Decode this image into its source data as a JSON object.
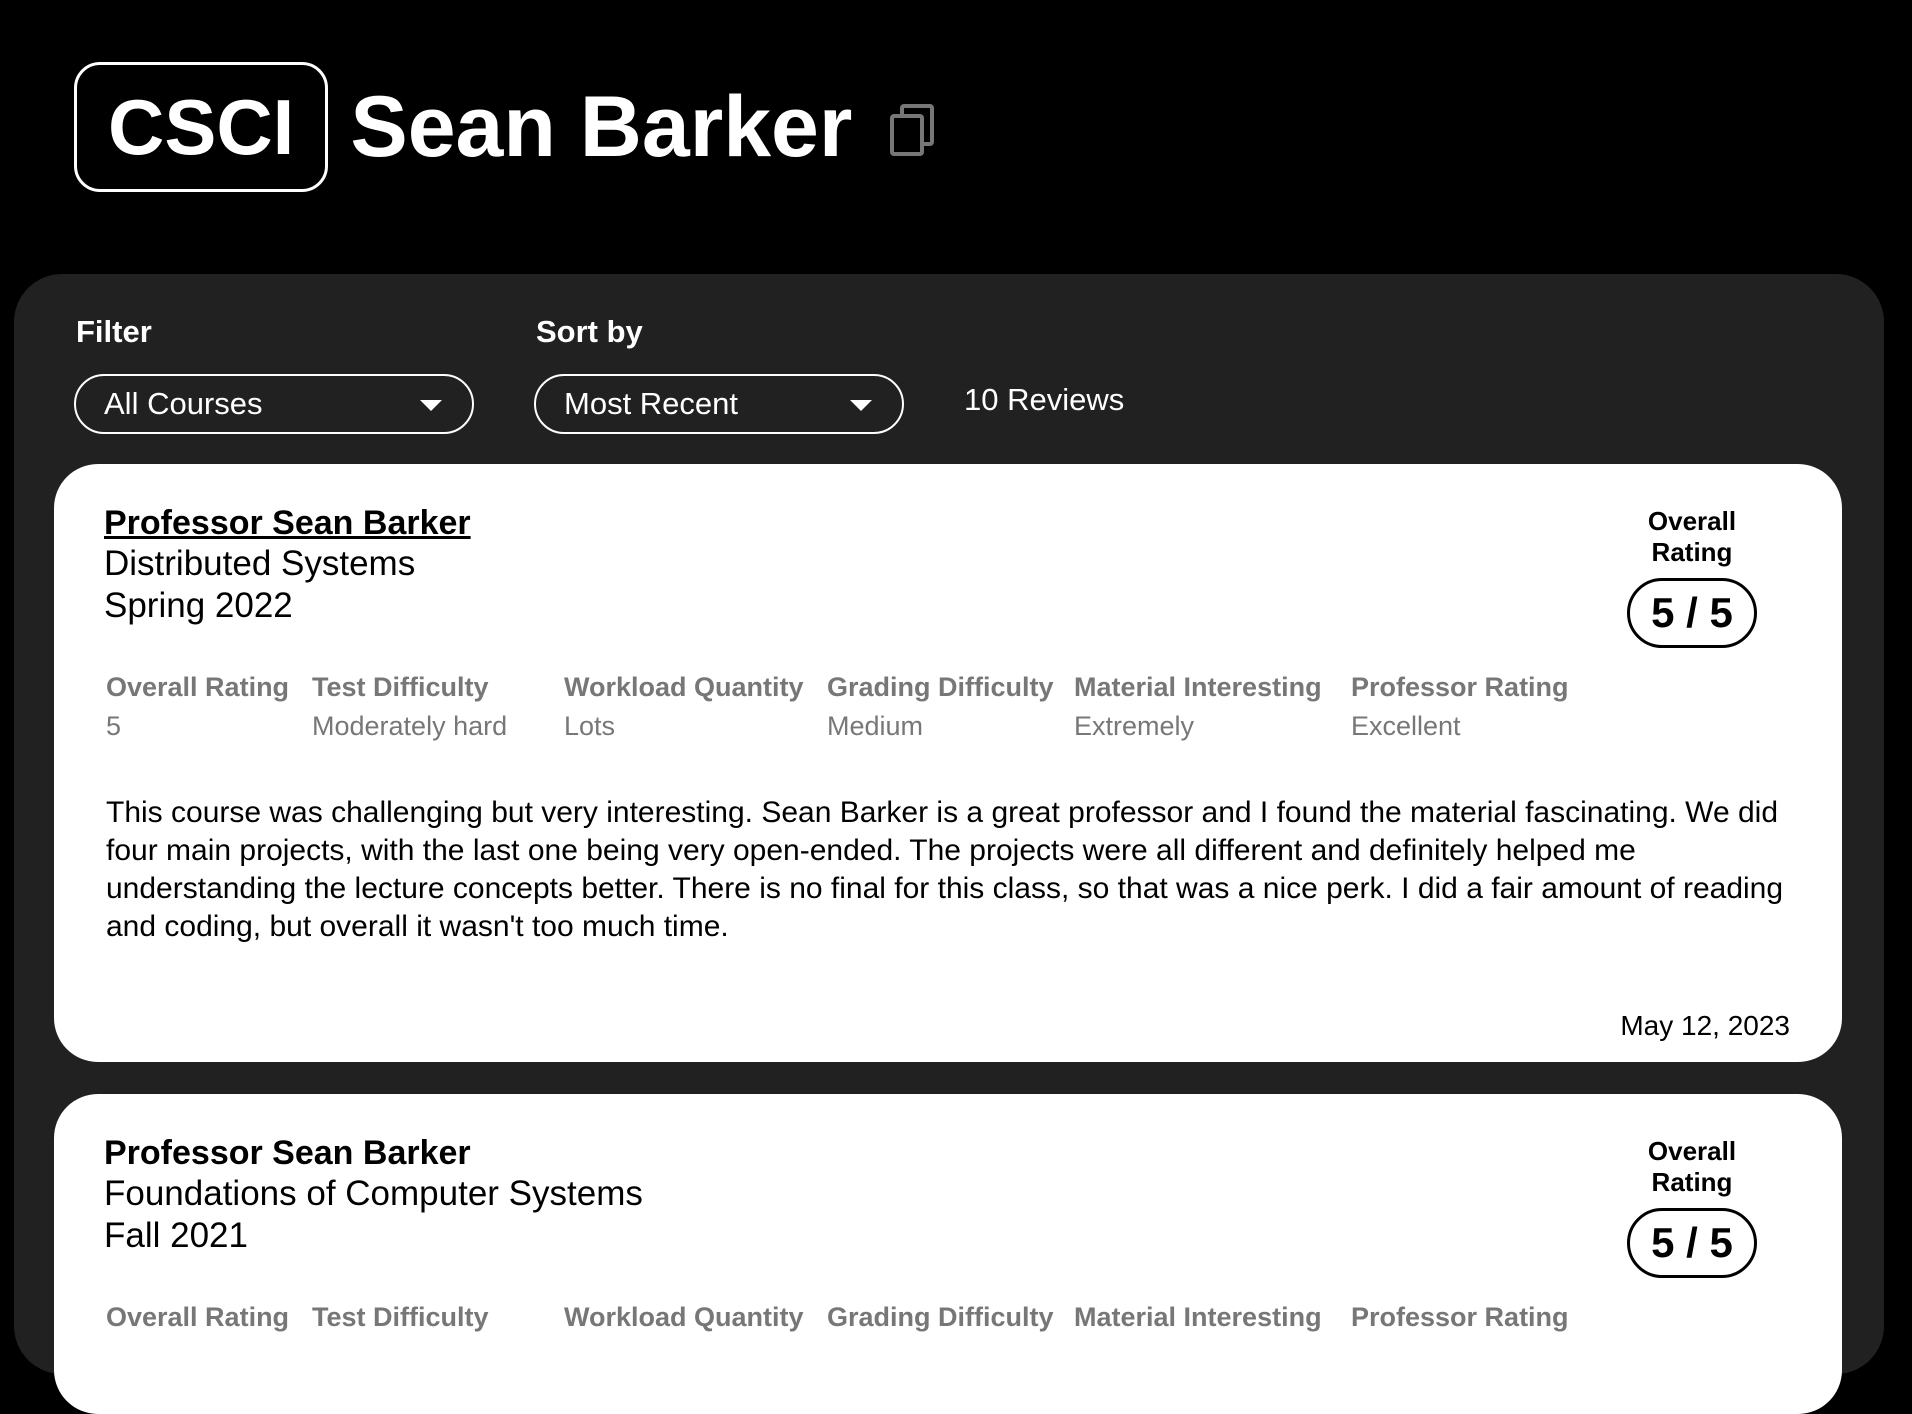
{
  "header": {
    "department": "CSCI",
    "professor": "Sean Barker",
    "copy_icon": "copy-icon"
  },
  "controls": {
    "filter_label": "Filter",
    "filter_value": "All Courses",
    "sort_label": "Sort by",
    "sort_value": "Most Recent",
    "review_count": "10 Reviews"
  },
  "reviews": [
    {
      "professor": "Professor Sean Barker",
      "course": "Distributed Systems",
      "term": "Spring 2022",
      "overall_label": "Overall Rating",
      "overall_score": "5 / 5",
      "metrics": [
        {
          "label": "Overall Rating",
          "value": "5"
        },
        {
          "label": "Test Difficulty",
          "value": "Moderately hard"
        },
        {
          "label": "Workload Quantity",
          "value": "Lots"
        },
        {
          "label": "Grading Difficulty",
          "value": "Medium"
        },
        {
          "label": "Material Interesting",
          "value": "Extremely"
        },
        {
          "label": "Professor Rating",
          "value": "Excellent"
        }
      ],
      "text": "This course was challenging but very interesting. Sean Barker is a great professor and I found the material fascinating. We did four main projects, with the last one being very open-ended. The projects were all different and definitely helped me understanding the lecture concepts better. There is no final for this class, so that was a nice perk. I did a fair amount of reading and coding, but overall it wasn't too much time.",
      "date": "May 12, 2023"
    },
    {
      "professor": "Professor Sean Barker",
      "course": "Foundations of Computer Systems",
      "term": "Fall 2021",
      "overall_label": "Overall Rating",
      "overall_score": "5 / 5",
      "metrics": [
        {
          "label": "Overall Rating"
        },
        {
          "label": "Test Difficulty"
        },
        {
          "label": "Workload Quantity"
        },
        {
          "label": "Grading Difficulty"
        },
        {
          "label": "Material Interesting"
        },
        {
          "label": "Professor Rating"
        }
      ]
    }
  ]
}
